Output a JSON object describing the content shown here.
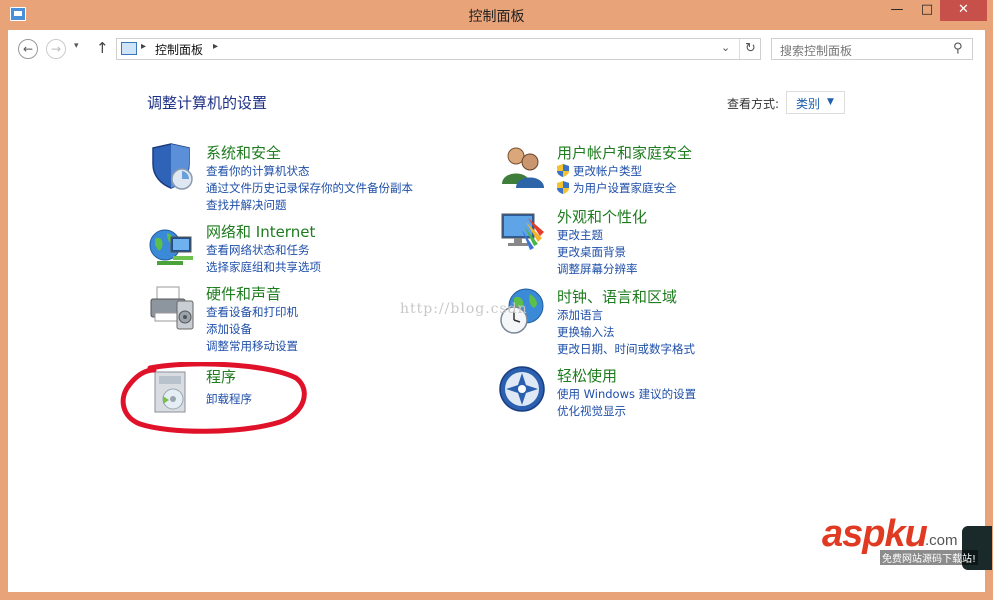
{
  "window": {
    "title": "控制面板",
    "minimize": "—",
    "maximize": "□",
    "close": "✕"
  },
  "nav": {
    "back": "←",
    "forward": "→",
    "recent": "▾",
    "up": "↑",
    "breadcrumb_sep": "▸",
    "address": "控制面板",
    "address_dropdown": "⌄",
    "refresh": "↻",
    "search_placeholder": "搜索控制面板",
    "search_icon": "⚲"
  },
  "main": {
    "heading": "调整计算机的设置",
    "view_by_label": "查看方式:",
    "view_by_value": "类别",
    "view_by_arrow": "▼"
  },
  "categories": {
    "system": {
      "title": "系统和安全",
      "links": [
        "查看你的计算机状态",
        "通过文件历史记录保存你的文件备份副本",
        "查找并解决问题"
      ]
    },
    "network": {
      "title": "网络和 Internet",
      "links": [
        "查看网络状态和任务",
        "选择家庭组和共享选项"
      ]
    },
    "hardware": {
      "title": "硬件和声音",
      "links": [
        "查看设备和打印机",
        "添加设备",
        "调整常用移动设置"
      ]
    },
    "programs": {
      "title": "程序",
      "links": [
        "卸载程序"
      ]
    },
    "user": {
      "title": "用户帐户和家庭安全",
      "links": [
        "更改帐户类型",
        "为用户设置家庭安全"
      ]
    },
    "appearance": {
      "title": "外观和个性化",
      "links": [
        "更改主题",
        "更改桌面背景",
        "调整屏幕分辨率"
      ]
    },
    "clock": {
      "title": "时钟、语言和区域",
      "links": [
        "添加语言",
        "更换输入法",
        "更改日期、时间或数字格式"
      ]
    },
    "ease": {
      "title": "轻松使用",
      "links": [
        "使用 Windows 建议的设置",
        "优化视觉显示"
      ]
    }
  },
  "overlay": {
    "watermark": "http://blog.csdn",
    "brand": "aspku",
    "brand_domain": ".com",
    "brand_tagline": "免费网站源码下载站!"
  },
  "colors": {
    "frame": "#e9a379",
    "category_title": "#1e7b1e",
    "link": "#1f4fa8",
    "heading": "#1e3287",
    "annotation": "#e0122a",
    "brand": "#e03a22"
  }
}
